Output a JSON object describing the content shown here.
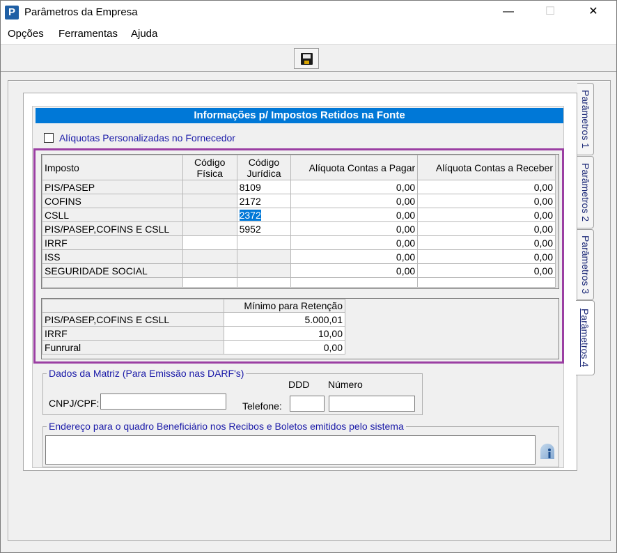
{
  "window": {
    "title": "Parâmetros da Empresa",
    "app_icon": "P",
    "minimize": "—",
    "maximize": "☐",
    "close": "✕"
  },
  "menu": {
    "items": [
      {
        "label": "Opções"
      },
      {
        "label": "Ferramentas"
      },
      {
        "label": "Ajuda"
      }
    ]
  },
  "toolbar": {
    "save_icon": "floppy-disk-icon"
  },
  "tabs": [
    {
      "label": "Parâmetros 1",
      "active": false
    },
    {
      "label": "Parâmetros 2",
      "active": false
    },
    {
      "label": "Parâmetros 3",
      "active": false
    },
    {
      "label": "Parâmetros 4",
      "active": true
    }
  ],
  "section": {
    "title": "Informações p/ Impostos Retidos na Fonte",
    "checkbox_label": "Alíquotas Personalizadas no Fornecedor",
    "checkbox_checked": false
  },
  "taxes_table": {
    "headers": {
      "imposto": "Imposto",
      "codigo_fisica": [
        "Código",
        "Física"
      ],
      "codigo_juridica": [
        "Código",
        "Jurídica"
      ],
      "aliquota_pagar": "Alíquota Contas a Pagar",
      "aliquota_receber": "Alíquota Contas a Receber"
    },
    "rows": [
      {
        "imposto": "PIS/PASEP",
        "fisica": "",
        "juridica": "8109",
        "pagar": "0,00",
        "receber": "0,00"
      },
      {
        "imposto": "COFINS",
        "fisica": "",
        "juridica": "2172",
        "pagar": "0,00",
        "receber": "0,00"
      },
      {
        "imposto": "CSLL",
        "fisica": "",
        "juridica": "2372",
        "pagar": "0,00",
        "receber": "0,00"
      },
      {
        "imposto": "PIS/PASEP,COFINS E CSLL",
        "fisica": "",
        "juridica": "5952",
        "pagar": "0,00",
        "receber": "0,00"
      },
      {
        "imposto": "IRRF",
        "fisica": "",
        "juridica": "",
        "pagar": "0,00",
        "receber": "0,00"
      },
      {
        "imposto": "ISS",
        "fisica": "",
        "juridica": "",
        "pagar": "0,00",
        "receber": "0,00"
      },
      {
        "imposto": "SEGURIDADE SOCIAL",
        "fisica": "",
        "juridica": "",
        "pagar": "0,00",
        "receber": "0,00"
      }
    ],
    "selected_cell": "2372"
  },
  "retention_table": {
    "header": "Mínimo para Retenção",
    "rows": [
      {
        "label": "PIS/PASEP,COFINS E CSLL",
        "value": "5.000,01"
      },
      {
        "label": "IRRF",
        "value": "10,00"
      },
      {
        "label": "Funrural",
        "value": "0,00"
      }
    ]
  },
  "matriz": {
    "legend": "Dados da Matriz (Para Emissão nas DARF's)",
    "cnpj_label": "CNPJ/CPF:",
    "cnpj_value": "",
    "telefone_label": "Telefone:",
    "ddd_label": "DDD",
    "ddd_value": "",
    "numero_label": "Número",
    "numero_value": ""
  },
  "endereco": {
    "legend": "Endereço para o quadro Beneficiário nos Recibos e Boletos emitidos pelo sistema",
    "value": "",
    "icon": "info-icon"
  },
  "colors": {
    "header_bar": "#0078d7",
    "highlight_border": "#9b3fa3",
    "label_blue": "#1a1aa8"
  }
}
